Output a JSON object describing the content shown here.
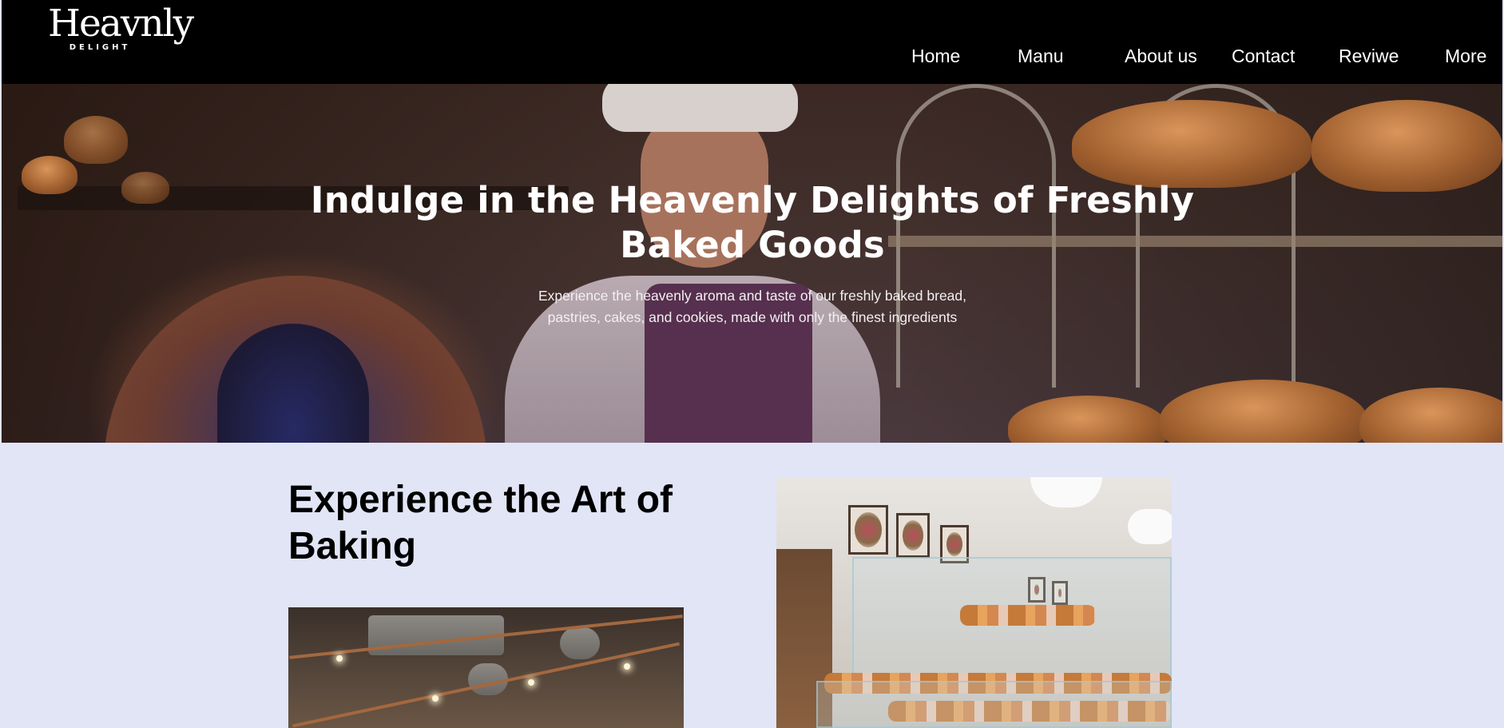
{
  "header": {
    "logo_word": "Heavnly",
    "logo_sub": "DELIGHT",
    "nav": [
      {
        "label": "Home"
      },
      {
        "label": "Manu"
      },
      {
        "label": "About us"
      },
      {
        "label": "Contact"
      },
      {
        "label": "Reviwe"
      },
      {
        "label": "More"
      }
    ]
  },
  "hero": {
    "title": "Indulge in the Heavenly Delights of Freshly Baked Goods",
    "subtitle": "Experience the heavenly aroma and taste of our freshly baked bread, pastries, cakes, and cookies, made with only the finest ingredients"
  },
  "section": {
    "title": "Experience the Art of Baking"
  },
  "colors": {
    "header_bg": "#000000",
    "page_bg": "#e1e5f6",
    "hero_text": "#ffffff"
  }
}
